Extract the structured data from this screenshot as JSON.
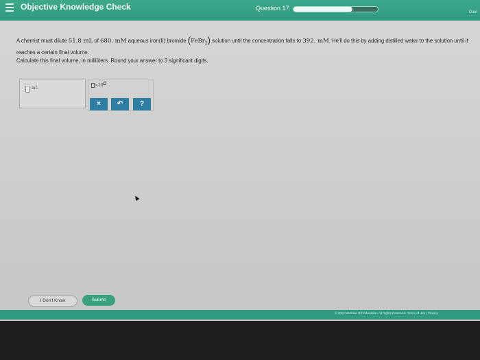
{
  "header": {
    "app_title": "Objective Knowledge Check",
    "question_label": "Question 17",
    "progress_fraction": 0.7,
    "corner_text": "Davi"
  },
  "problem": {
    "part1": "A chemist must dilute ",
    "volume": "51.8 mL",
    "part2": " of ",
    "concentration": "680. mM",
    "part3": " aqueous iron(II) bromide ",
    "formula": "FeBr",
    "formula_sub": "2",
    "part4": " solution until the concentration falls to ",
    "final_concentration": "392. mM",
    "part5": ". He'll do this by adding distilled water to the solution until it reaches a certain final volume."
  },
  "instruction": "Calculate this final volume, in milliliters. Round your answer to 3 significant digits.",
  "answer": {
    "value": "",
    "unit": "mL"
  },
  "tools": {
    "sci_label": "×10",
    "clear_label": "×",
    "undo_label": "↶",
    "help_label": "?"
  },
  "buttons": {
    "dont_know": "I Don't Know",
    "submit": "Submit"
  },
  "footer": {
    "copyright": "© 2019 McGraw-Hill Education. All Rights Reserved.   Terms of Use  |  Privacy"
  },
  "colors": {
    "brand_green": "#2f9a7f",
    "tool_blue": "#2e7ea3"
  }
}
